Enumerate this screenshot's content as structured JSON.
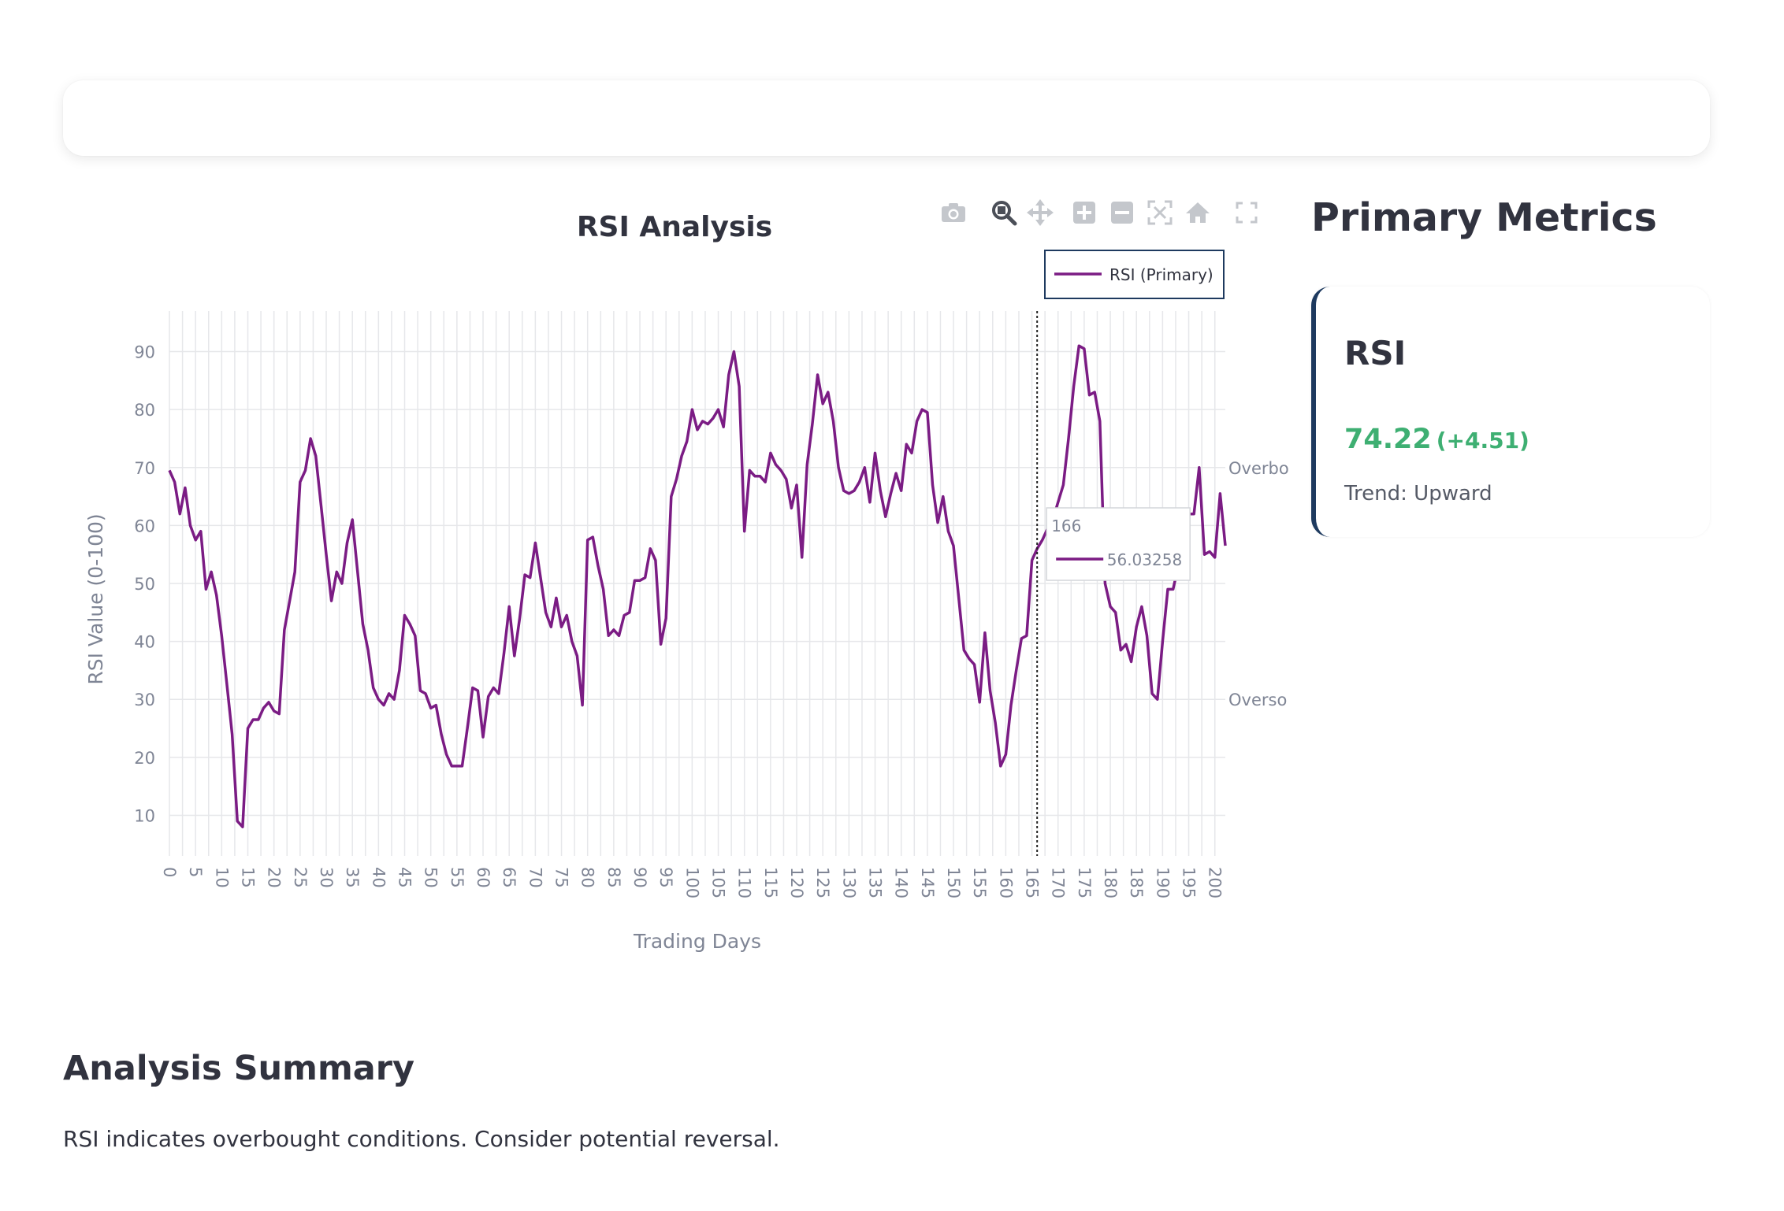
{
  "header": {
    "title": ""
  },
  "chart_data": {
    "type": "line",
    "title": "RSI Analysis",
    "xlabel": "Trading Days",
    "ylabel": "RSI Value (0-100)",
    "xlim": [
      0,
      202
    ],
    "ylim": [
      3,
      97
    ],
    "y_ticks": [
      10,
      20,
      30,
      40,
      50,
      60,
      70,
      80,
      90
    ],
    "y_tick_labels": [
      "10",
      "20",
      "30",
      "40",
      "50",
      "60",
      "70",
      "80",
      "90"
    ],
    "x_ticks": [
      0,
      5,
      10,
      15,
      20,
      25,
      30,
      35,
      40,
      45,
      50,
      55,
      60,
      65,
      70,
      75,
      80,
      85,
      90,
      95,
      100,
      105,
      110,
      115,
      120,
      125,
      130,
      135,
      140,
      145,
      150,
      155,
      160,
      165,
      170,
      175,
      180,
      185,
      190,
      195,
      200
    ],
    "x_tick_labels": [
      "0",
      "5",
      "10",
      "15",
      "20",
      "25",
      "30",
      "35",
      "40",
      "45",
      "50",
      "55",
      "60",
      "65",
      "70",
      "75",
      "80",
      "85",
      "90",
      "95",
      "100",
      "105",
      "110",
      "115",
      "120",
      "125",
      "130",
      "135",
      "140",
      "145",
      "150",
      "155",
      "160",
      "165",
      "170",
      "175",
      "180",
      "185",
      "190",
      "195",
      "200"
    ],
    "grid": true,
    "legend_position": "top-right",
    "series": [
      {
        "name": "RSI (Primary)",
        "color": "#7b1c84",
        "x": [
          0,
          1,
          2,
          3,
          4,
          5,
          6,
          7,
          8,
          9,
          10,
          11,
          12,
          13,
          14,
          15,
          16,
          17,
          18,
          19,
          20,
          21,
          22,
          23,
          24,
          25,
          26,
          27,
          28,
          29,
          30,
          31,
          32,
          33,
          34,
          35,
          36,
          37,
          38,
          39,
          40,
          41,
          42,
          43,
          44,
          45,
          46,
          47,
          48,
          49,
          50,
          51,
          52,
          53,
          54,
          55,
          56,
          57,
          58,
          59,
          60,
          61,
          62,
          63,
          64,
          65,
          66,
          67,
          68,
          69,
          70,
          71,
          72,
          73,
          74,
          75,
          76,
          77,
          78,
          79,
          80,
          81,
          82,
          83,
          84,
          85,
          86,
          87,
          88,
          89,
          90,
          91,
          92,
          93,
          94,
          95,
          96,
          97,
          98,
          99,
          100,
          101,
          102,
          103,
          104,
          105,
          106,
          107,
          108,
          109,
          110,
          111,
          112,
          113,
          114,
          115,
          116,
          117,
          118,
          119,
          120,
          121,
          122,
          123,
          124,
          125,
          126,
          127,
          128,
          129,
          130,
          131,
          132,
          133,
          134,
          135,
          136,
          137,
          138,
          139,
          140,
          141,
          142,
          143,
          144,
          145,
          146,
          147,
          148,
          149,
          150,
          151,
          152,
          153,
          154,
          155,
          156,
          157,
          158,
          159,
          160,
          161,
          162,
          163,
          164,
          165,
          166,
          167,
          168,
          169,
          170,
          171,
          172,
          173,
          174,
          175,
          176,
          177,
          178,
          179,
          180,
          181,
          182,
          183,
          184,
          185,
          186,
          187,
          188,
          189,
          190,
          191,
          192,
          193,
          194,
          195,
          196,
          197,
          198,
          199,
          200,
          201,
          202
        ],
        "y": [
          69.5,
          67.5,
          62,
          66.5,
          60,
          57.5,
          59,
          49,
          52,
          48,
          41,
          32.5,
          24,
          9,
          8,
          25,
          26.5,
          26.5,
          28.5,
          29.5,
          28,
          27.5,
          42,
          47,
          52,
          67.5,
          69.5,
          75,
          72,
          63.5,
          55,
          47,
          52,
          50,
          57,
          61,
          52,
          43,
          38.5,
          32,
          30,
          29,
          31,
          30,
          35,
          44.5,
          43,
          41,
          31.5,
          31,
          28.5,
          29,
          24,
          20.5,
          18.5,
          18.5,
          18.5,
          25,
          32,
          31.5,
          23.5,
          30.5,
          32,
          31,
          38,
          46,
          37.5,
          44,
          51.5,
          51,
          57,
          51,
          45,
          42.5,
          47.5,
          42.5,
          44.5,
          40,
          37.5,
          29,
          57.5,
          58,
          53,
          49,
          41,
          42,
          41,
          44.5,
          45,
          50.5,
          50.5,
          51,
          56,
          54,
          39.5,
          44,
          65,
          68,
          72,
          74.5,
          80,
          76.5,
          78,
          77.5,
          78.5,
          80,
          77,
          86,
          90,
          84,
          59,
          69.5,
          68.5,
          68.5,
          67.5,
          72.5,
          70.5,
          69.5,
          68,
          63,
          67,
          54.5,
          70.5,
          77.5,
          86,
          81,
          83,
          78,
          70,
          66,
          65.5,
          66,
          67.5,
          70,
          64,
          72.5,
          66,
          61.5,
          65.5,
          69,
          66,
          74,
          72.5,
          78,
          80,
          79.5,
          67,
          60.5,
          65,
          59,
          56.5,
          47.5,
          38.5,
          37,
          36,
          29.5,
          41.5,
          31.5,
          26,
          18.5,
          20.5,
          29,
          35,
          40.5,
          41,
          54,
          56,
          57.5,
          59.5,
          61,
          64,
          67,
          75,
          84,
          91,
          90.5,
          82.5,
          83,
          78,
          50,
          46,
          45,
          38.5,
          39.5,
          36.5,
          42.5,
          46,
          41,
          31,
          30,
          40,
          49,
          49,
          53,
          57,
          62,
          62,
          70,
          55,
          55.5,
          54.5,
          65.5,
          56.5
        ]
      }
    ],
    "annotations": [
      {
        "text": "Overbought",
        "y": 70
      },
      {
        "text": "Oversold",
        "y": 30
      }
    ],
    "hover": {
      "x_label": "166",
      "value_label": "56.03258",
      "x": 166
    }
  },
  "sidebar": {
    "title": "Primary Metrics",
    "metric": {
      "name": "RSI",
      "value": "74.22",
      "delta": "(+4.51)",
      "trend": "Trend: Upward",
      "value_color": "#3eaf72",
      "accent": "#1e3a5f"
    }
  },
  "summary": {
    "title": "Analysis Summary",
    "text": "RSI indicates overbought conditions. Consider potential reversal."
  },
  "modebar": {
    "icons": [
      "camera-icon",
      "zoom-icon",
      "pan-icon",
      "zoom-in-icon",
      "zoom-out-icon",
      "autoscale-icon",
      "reset-axes-icon",
      "fullscreen-icon"
    ]
  }
}
